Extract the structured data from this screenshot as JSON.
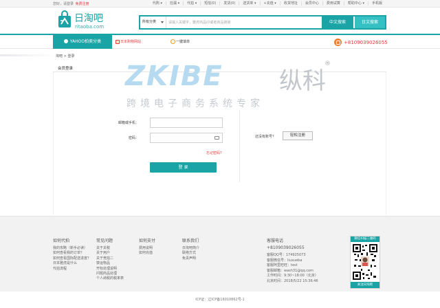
{
  "topbar": {
    "welcome": "您好，请登录",
    "register": "免费注册",
    "nav": [
      "代购 ▾",
      "捡漏 ▾",
      "代拍 ▾",
      "短信(0)",
      "发货(0)",
      "送货单 ▾",
      "+充值 ▾",
      "收货地址",
      "会员中心",
      "费用试算",
      "帮助中心 ▾",
      "手机版"
    ]
  },
  "logo": {
    "name": "日淘吧",
    "domain": "ritaoba.com"
  },
  "search": {
    "category": "所有分类",
    "placeholder": "请输入关键字，雅虎商品ID或者商品链接",
    "btn_cn": "中文搜索",
    "btn_jp": "日文搜索"
  },
  "navbar": {
    "yahoo": "YAHOO拍卖分类",
    "jp_sites": "日本购物网站",
    "order": "一键填单",
    "phone": "+8109039026055"
  },
  "breadcrumb": "淘吧 > 登录",
  "member_title": "会员登录",
  "watermark": {
    "latin": "ZKIBE",
    "cn": "纵科",
    "reg": "®",
    "sub": "跨境电子商务系统专家"
  },
  "form": {
    "email_label": "邮箱或手机：",
    "password_label": "密码：",
    "forgot": "忘记密码？",
    "login": "登 录",
    "have_account": "还没有账号？",
    "register": "轻松注册"
  },
  "footer": {
    "columns": [
      {
        "title": "如何代拍",
        "items": [
          "我的攻略（新手必读）",
          "如何查看我的订单？",
          "如何查看国际配送进度？",
          "日本雅虎是什么",
          "代拍流程"
        ]
      },
      {
        "title": "常见问题",
        "items": [
          "关于关税",
          "关于用户",
          "关于竞拍二",
          "禁运物品",
          "开标处理说明",
          "问题商品处理",
          "个人纳税的税率表"
        ]
      },
      {
        "title": "如何支付",
        "items": [
          "费用说明",
          "如何充值"
        ]
      },
      {
        "title": "联系我们",
        "items": [
          "日淘吧简介",
          "联络方式",
          "免责声明"
        ]
      }
    ],
    "contact": {
      "title": "客服电话",
      "tel": "+8109039026055",
      "lines": [
        "客服QQ号：174925073",
        "客服微信号：liuxueba",
        "客服阿里旺旺：test",
        "客服邮箱：wash31@qq.com",
        "工作时间：9:30~18:00（北京）",
        "北京时间：2018/5/22 15:36:46"
      ]
    },
    "qr_title": "微信扫描二维码",
    "qr_footer": "关注日淘吧",
    "icp": "ICP证：辽ICP备16010862号-1"
  },
  "colors": {
    "accent": "#1aa4a6",
    "accent_light": "#35c1c3",
    "alert": "#e4393c"
  }
}
